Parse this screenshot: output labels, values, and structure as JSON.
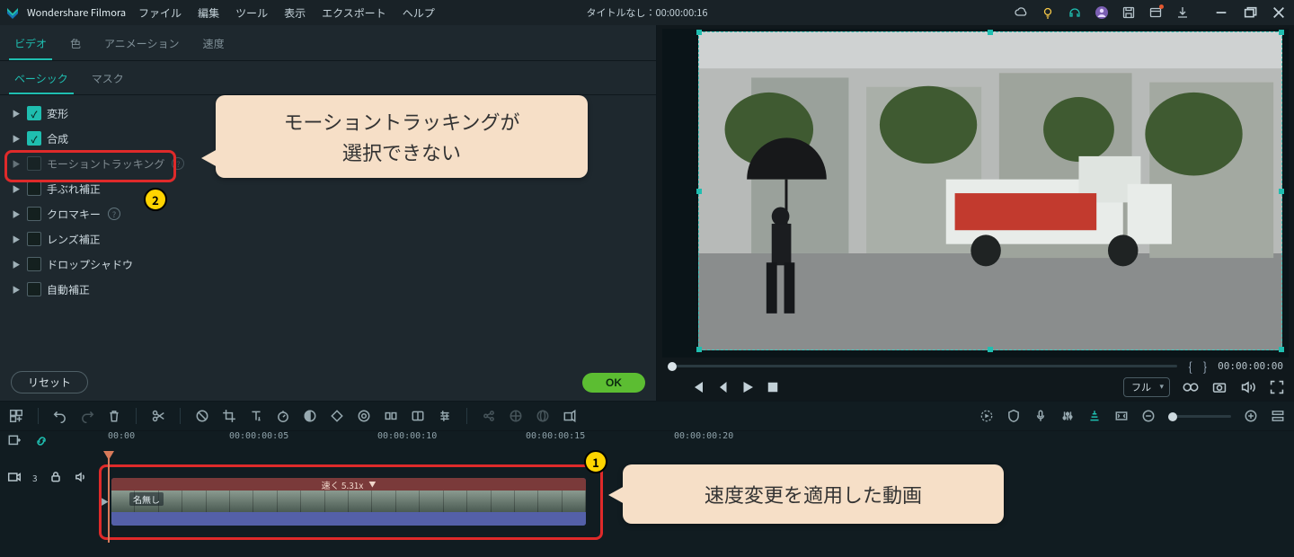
{
  "title": {
    "brand": "Wondershare Filmora",
    "project": "タイトルなし：00:00:00:16"
  },
  "menu": {
    "file": "ファイル",
    "edit": "編集",
    "tool": "ツール",
    "view": "表示",
    "export": "エクスポート",
    "help": "ヘルプ"
  },
  "tabs": {
    "video": "ビデオ",
    "color": "色",
    "animation": "アニメーション",
    "speed": "速度"
  },
  "subtabs": {
    "basic": "ベーシック",
    "mask": "マスク"
  },
  "props": {
    "transform": {
      "label": "変形",
      "checked": true,
      "enabled": true
    },
    "composite": {
      "label": "合成",
      "checked": true,
      "enabled": true
    },
    "motion_track": {
      "label": "モーショントラッキング",
      "checked": false,
      "enabled": false,
      "help": true
    },
    "stabilize": {
      "label": "手ぶれ補正",
      "checked": false,
      "enabled": true
    },
    "chromakey": {
      "label": "クロマキー",
      "checked": false,
      "enabled": true,
      "help": true
    },
    "lens": {
      "label": "レンズ補正",
      "checked": false,
      "enabled": true
    },
    "dropshadow": {
      "label": "ドロップシャドウ",
      "checked": false,
      "enabled": true
    },
    "autocorrect": {
      "label": "自動補正",
      "checked": false,
      "enabled": true
    }
  },
  "buttons": {
    "reset": "リセット",
    "ok": "OK"
  },
  "preview": {
    "quality": "フル",
    "timecode": "00:00:00:00"
  },
  "ruler": {
    "t0": "00:00",
    "t1": "00:00:00:05",
    "t2": "00:00:00:10",
    "t3": "00:00:00:15",
    "t4": "00:00:00:20"
  },
  "clip": {
    "speed_label": "速く 5.31x",
    "name": "名無し"
  },
  "track": {
    "label": "3"
  },
  "callouts": {
    "c1": {
      "text": "速度変更を適用した動画",
      "marker": "1"
    },
    "c2": {
      "line1": "モーショントラッキングが",
      "line2": "選択できない",
      "marker": "2"
    }
  }
}
